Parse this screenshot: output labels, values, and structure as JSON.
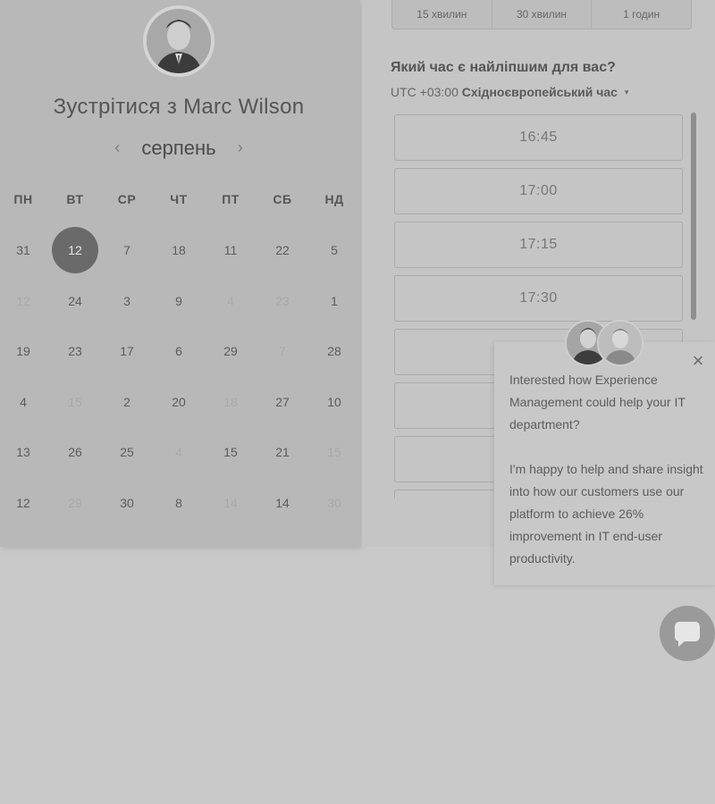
{
  "profile": {
    "title": "Зустрітися з Marc Wilson"
  },
  "calendar": {
    "month": "серпень",
    "prev_arrow": "‹",
    "next_arrow": "›",
    "weekdays": [
      "ПН",
      "ВТ",
      "СР",
      "ЧТ",
      "ПТ",
      "СБ",
      "НД"
    ],
    "rows": [
      [
        {
          "d": "31",
          "s": "n"
        },
        {
          "d": "12",
          "s": "sel"
        },
        {
          "d": "7",
          "s": "n"
        },
        {
          "d": "18",
          "s": "n"
        },
        {
          "d": "11",
          "s": "n"
        },
        {
          "d": "22",
          "s": "n"
        },
        {
          "d": "5",
          "s": "n"
        }
      ],
      [
        {
          "d": "12",
          "s": "f"
        },
        {
          "d": "24",
          "s": "n"
        },
        {
          "d": "3",
          "s": "n"
        },
        {
          "d": "9",
          "s": "n"
        },
        {
          "d": "4",
          "s": "f"
        },
        {
          "d": "23",
          "s": "f"
        },
        {
          "d": "1",
          "s": "n"
        }
      ],
      [
        {
          "d": "19",
          "s": "n"
        },
        {
          "d": "23",
          "s": "n"
        },
        {
          "d": "17",
          "s": "n"
        },
        {
          "d": "6",
          "s": "n"
        },
        {
          "d": "29",
          "s": "n"
        },
        {
          "d": "7",
          "s": "f"
        },
        {
          "d": "28",
          "s": "n"
        }
      ],
      [
        {
          "d": "4",
          "s": "n"
        },
        {
          "d": "15",
          "s": "f"
        },
        {
          "d": "2",
          "s": "n"
        },
        {
          "d": "20",
          "s": "n"
        },
        {
          "d": "18",
          "s": "f"
        },
        {
          "d": "27",
          "s": "n"
        },
        {
          "d": "10",
          "s": "n"
        }
      ],
      [
        {
          "d": "13",
          "s": "n"
        },
        {
          "d": "26",
          "s": "n"
        },
        {
          "d": "25",
          "s": "n"
        },
        {
          "d": "4",
          "s": "f"
        },
        {
          "d": "15",
          "s": "n"
        },
        {
          "d": "21",
          "s": "n"
        },
        {
          "d": "15",
          "s": "f"
        }
      ],
      [
        {
          "d": "12",
          "s": "n"
        },
        {
          "d": "29",
          "s": "f"
        },
        {
          "d": "30",
          "s": "n"
        },
        {
          "d": "8",
          "s": "n"
        },
        {
          "d": "14",
          "s": "f"
        },
        {
          "d": "14",
          "s": "n"
        },
        {
          "d": "30",
          "s": "f"
        }
      ]
    ]
  },
  "durations": [
    "15 хвилин",
    "30 хвилин",
    "1 годин"
  ],
  "question": "Який час є найліпшим для вас?",
  "timezone": {
    "offset": "UTC +03:00",
    "name": "Східноєвропейський час",
    "caret": "▾"
  },
  "time_slots": [
    "16:45",
    "17:00",
    "17:15",
    "17:30",
    "",
    "",
    "",
    ""
  ],
  "chat": {
    "close": "×",
    "message_1": "Interested how Experience Management could help your IT department?",
    "message_2": "I'm happy to help and share insight into how our customers use our platform to achieve 26% improvement in IT end-user productivity."
  }
}
